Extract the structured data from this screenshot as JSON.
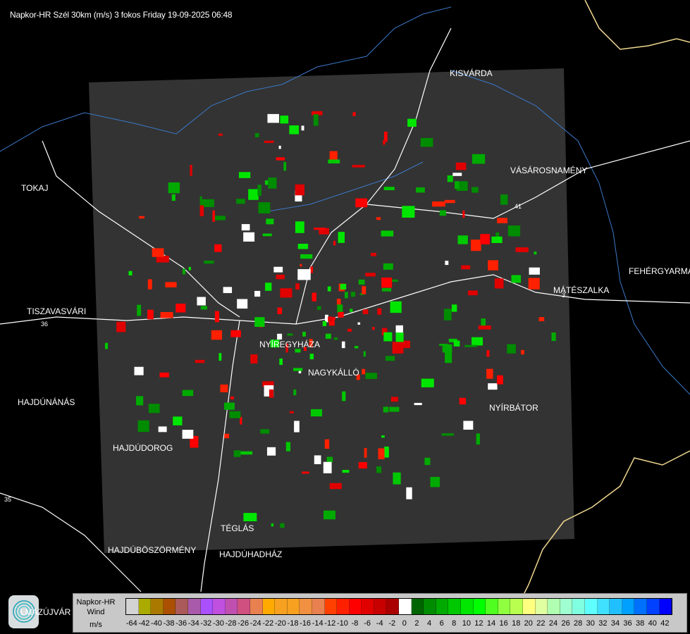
{
  "title": "Napkor-HR Szél 30km (m/s) 3 fokos Friday 19-09-2025 06:48",
  "colors": {
    "radar_area": "#333333",
    "roads": "#ffffff",
    "rivers": "#3a78c8",
    "border": "#f0d890",
    "outlines": "#cfcfcf"
  },
  "cities": [
    {
      "id": "kisvarda",
      "label": "KISVÁRDA"
    },
    {
      "id": "tokaj",
      "label": "TOKAJ"
    },
    {
      "id": "vasarosnameny",
      "label": "VÁSÁROSNAMÉNY"
    },
    {
      "id": "fehergyarmat",
      "label": "FEHÉRGYARMA"
    },
    {
      "id": "mateszalka",
      "label": "MÁTÉSZALKA"
    },
    {
      "id": "tiszavasvari",
      "label": "TISZAVASVÁRI"
    },
    {
      "id": "nyiregyhaza",
      "label": "NYÍREGYHÁZA"
    },
    {
      "id": "nagykallo",
      "label": "NAGYKÁLLÓ"
    },
    {
      "id": "hajdunanas",
      "label": "HAJDÚNÁNÁS"
    },
    {
      "id": "nyirbator",
      "label": "NYÍRBÁTOR"
    },
    {
      "id": "hajdudorog",
      "label": "HAJDÚDOROG"
    },
    {
      "id": "teglas",
      "label": "TÉGLÁS"
    },
    {
      "id": "hajduboszormeny",
      "label": "HAJDÚBÖSZÖRMÉNY"
    },
    {
      "id": "hajduhadhaz",
      "label": "HAJDÚHADHÁZ"
    }
  ],
  "road_numbers": [
    "36",
    "35",
    "41",
    "3"
  ],
  "logo": {
    "text": "LMAZÚJVÁR"
  },
  "legend": {
    "line1": "Napkor-HR",
    "line2": "Wind",
    "unit": "m/s",
    "bins": [
      {
        "label": "-64",
        "color": "#d3d3d3"
      },
      {
        "label": "-42",
        "color": "#aaaa00"
      },
      {
        "label": "-40",
        "color": "#aa7a00"
      },
      {
        "label": "-38",
        "color": "#aa5000"
      },
      {
        "label": "-36",
        "color": "#aa5a5a"
      },
      {
        "label": "-34",
        "color": "#aa5aaa"
      },
      {
        "label": "-32",
        "color": "#aa50ff"
      },
      {
        "label": "-30",
        "color": "#c050e0"
      },
      {
        "label": "-28",
        "color": "#c050b0"
      },
      {
        "label": "-26",
        "color": "#d05080"
      },
      {
        "label": "-24",
        "color": "#e88050"
      },
      {
        "label": "-22",
        "color": "#ffaa00"
      },
      {
        "label": "-20",
        "color": "#f8a020"
      },
      {
        "label": "-18",
        "color": "#f8a020"
      },
      {
        "label": "-16",
        "color": "#f09040"
      },
      {
        "label": "-14",
        "color": "#e88050"
      },
      {
        "label": "-12",
        "color": "#ff4000"
      },
      {
        "label": "-10",
        "color": "#ff2000"
      },
      {
        "label": "-8",
        "color": "#ff0000"
      },
      {
        "label": "-6",
        "color": "#e00000"
      },
      {
        "label": "-4",
        "color": "#c80000"
      },
      {
        "label": "-2",
        "color": "#aa0000"
      },
      {
        "label": "0",
        "color": "#ffffff"
      },
      {
        "label": "2",
        "color": "#006400"
      },
      {
        "label": "4",
        "color": "#008c00"
      },
      {
        "label": "6",
        "color": "#00aa00"
      },
      {
        "label": "8",
        "color": "#00c800"
      },
      {
        "label": "10",
        "color": "#00e600"
      },
      {
        "label": "12",
        "color": "#00ff00"
      },
      {
        "label": "14",
        "color": "#50ff20"
      },
      {
        "label": "16",
        "color": "#90ff40"
      },
      {
        "label": "18",
        "color": "#b8ff50"
      },
      {
        "label": "20",
        "color": "#ffff80"
      },
      {
        "label": "22",
        "color": "#e0ffa0"
      },
      {
        "label": "24",
        "color": "#b0ffb0"
      },
      {
        "label": "26",
        "color": "#a0ffd0"
      },
      {
        "label": "28",
        "color": "#80ffe0"
      },
      {
        "label": "30",
        "color": "#60ffff"
      },
      {
        "label": "32",
        "color": "#40e0ff"
      },
      {
        "label": "34",
        "color": "#20c0ff"
      },
      {
        "label": "36",
        "color": "#00a0ff"
      },
      {
        "label": "38",
        "color": "#0070ff"
      },
      {
        "label": "40",
        "color": "#0040ff"
      },
      {
        "label": "42",
        "color": "#0000ff"
      }
    ]
  }
}
